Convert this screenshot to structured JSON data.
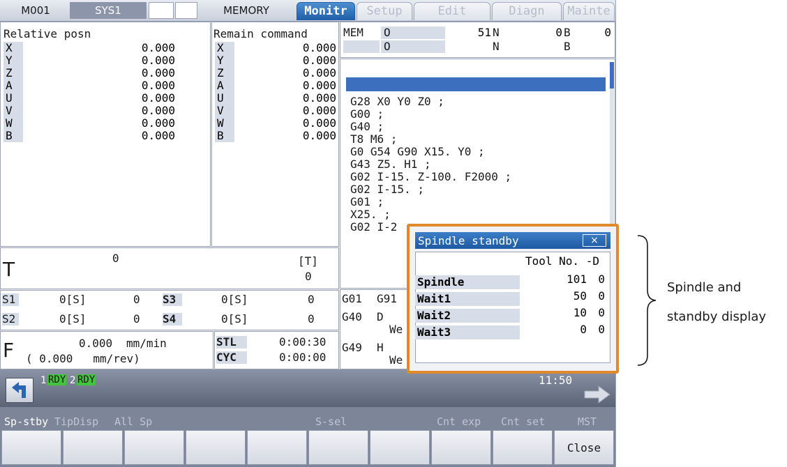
{
  "topbar": {
    "program": "M001",
    "system": "SYS1",
    "mode": "MEMORY",
    "tabs": [
      {
        "label": "Monitr",
        "active": true
      },
      {
        "label": "Setup",
        "active": false
      },
      {
        "label": "Edit",
        "active": false
      },
      {
        "label": "Diagn",
        "active": false
      },
      {
        "label": "Mainte",
        "active": false
      }
    ]
  },
  "relative_posn": {
    "title": "Relative posn",
    "axes": [
      {
        "axis": "X",
        "value": "0.000"
      },
      {
        "axis": "Y",
        "value": "0.000"
      },
      {
        "axis": "Z",
        "value": "0.000"
      },
      {
        "axis": "A",
        "value": "0.000"
      },
      {
        "axis": "U",
        "value": "0.000"
      },
      {
        "axis": "V",
        "value": "0.000"
      },
      {
        "axis": "W",
        "value": "0.000"
      },
      {
        "axis": "B",
        "value": "0.000"
      }
    ]
  },
  "remain_command": {
    "title": "Remain command",
    "axes": [
      {
        "axis": "X",
        "value": "0.000"
      },
      {
        "axis": "Y",
        "value": "0.000"
      },
      {
        "axis": "Z",
        "value": "0.000"
      },
      {
        "axis": "A",
        "value": "0.000"
      },
      {
        "axis": "U",
        "value": "0.000"
      },
      {
        "axis": "V",
        "value": "0.000"
      },
      {
        "axis": "W",
        "value": "0.000"
      },
      {
        "axis": "B",
        "value": "0.000"
      }
    ]
  },
  "program_header": {
    "mode": "MEM",
    "o_label": "O",
    "o_value": "51",
    "n_label": "N",
    "n_value": "0",
    "b_label": "B",
    "b_value": "0",
    "o2_label": "O",
    "n2_label": "N",
    "b2_label": "B"
  },
  "program_lines": [
    "G28 X0 Y0 Z0 ;",
    "G00 ;",
    "G40 ;",
    "T8 M6 ;",
    "G0 G54 G90 X15. Y0 ;",
    "G43 Z5. H1 ;",
    "G02 I-15. Z-100. F2000 ;",
    "G02 I-15. ;",
    "G01 ;",
    "X25. ;",
    "G02 I-2"
  ],
  "tool": {
    "label": "T",
    "value": "0",
    "bracket_label": "[T]",
    "bracket_value": "0"
  },
  "spindles": [
    {
      "name": "S1",
      "speed": "0[S]",
      "load": "0"
    },
    {
      "name": "S3",
      "speed": "0[S]",
      "load": "0"
    },
    {
      "name": "S2",
      "speed": "0[S]",
      "load": "0"
    },
    {
      "name": "S4",
      "speed": "0[S]",
      "load": "0"
    }
  ],
  "feed": {
    "label": "F",
    "value": "0.000",
    "unit": "mm/min",
    "rev_line": "( 0.000   mm/rev)"
  },
  "times": {
    "stl_label": "STL",
    "stl_value": "0:00:30",
    "cyc_label": "CYC",
    "cyc_value": "0:00:00"
  },
  "modal": {
    "r1c1": "G01",
    "r1c2": "G91",
    "r2c1": "G40",
    "r2c2": "D",
    "r2c3": "We",
    "r3c1": "G49",
    "r3c2": "H",
    "r3c3": "We"
  },
  "status": {
    "rdy1_num": "1",
    "rdy1": "RDY",
    "rdy2_num": "2",
    "rdy2": "RDY",
    "clock": "11:50"
  },
  "menu": {
    "labels": [
      "Sp-stby",
      "TipDisp",
      "All Sp",
      "S-sel",
      "Cnt exp",
      "Cnt set",
      "MST"
    ],
    "close": "Close"
  },
  "popup": {
    "title": "Spindle standby",
    "close_glyph": "×",
    "col_header": "Tool No. -D",
    "rows": [
      {
        "label": "Spindle",
        "tool": "101",
        "d": "0"
      },
      {
        "label": "Wait1",
        "tool": "50",
        "d": "0"
      },
      {
        "label": "Wait2",
        "tool": "10",
        "d": "0"
      },
      {
        "label": "Wait3",
        "tool": "0",
        "d": "0"
      }
    ]
  },
  "annotation": {
    "line1": "Spindle and",
    "line2": "standby display"
  }
}
